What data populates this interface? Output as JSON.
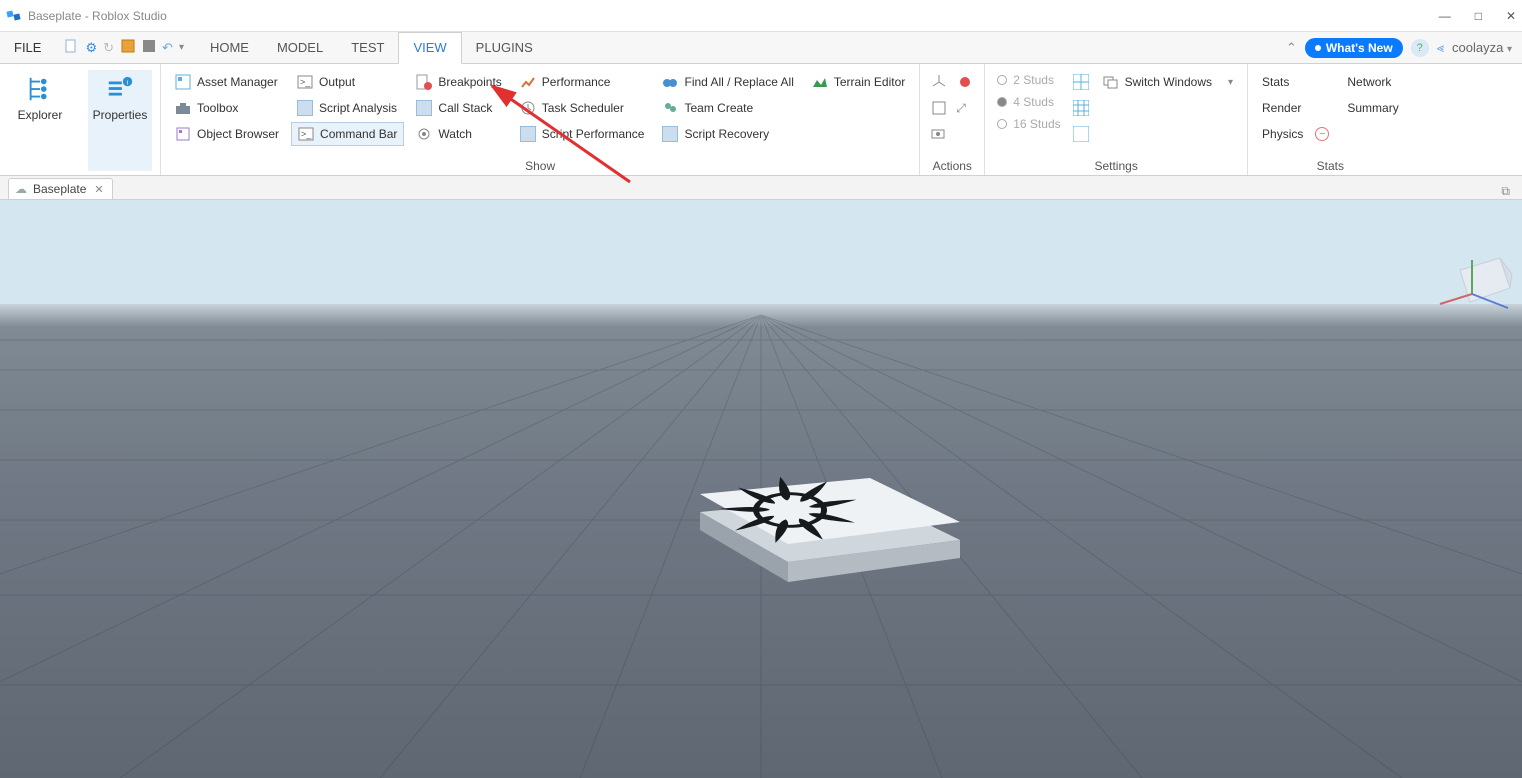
{
  "title": "Baseplate - Roblox Studio",
  "file_menu": "FILE",
  "tabs": {
    "home": "HOME",
    "model": "MODEL",
    "test": "TEST",
    "view": "VIEW",
    "plugins": "PLUGINS"
  },
  "user": {
    "name": "coolayza",
    "whats_new": "What's New"
  },
  "ribbon": {
    "explorer": "Explorer",
    "properties": "Properties",
    "show": {
      "label": "Show",
      "asset_manager": "Asset Manager",
      "toolbox": "Toolbox",
      "object_browser": "Object Browser",
      "output": "Output",
      "script_analysis": "Script Analysis",
      "command_bar": "Command Bar",
      "breakpoints": "Breakpoints",
      "call_stack": "Call Stack",
      "watch": "Watch",
      "performance": "Performance",
      "task_scheduler": "Task Scheduler",
      "script_performance": "Script Performance",
      "find_all": "Find All / Replace All",
      "team_create": "Team Create",
      "script_recovery": "Script Recovery",
      "terrain_editor": "Terrain Editor"
    },
    "actions": "Actions",
    "settings": {
      "label": "Settings",
      "studs2": "2 Studs",
      "studs4": "4 Studs",
      "studs16": "16 Studs",
      "switch_windows": "Switch Windows"
    },
    "stats": {
      "label": "Stats",
      "stats": "Stats",
      "render": "Render",
      "physics": "Physics",
      "network": "Network",
      "summary": "Summary"
    }
  },
  "doc_tab": {
    "name": "Baseplate"
  },
  "annotation_target": "breakpoints-button"
}
